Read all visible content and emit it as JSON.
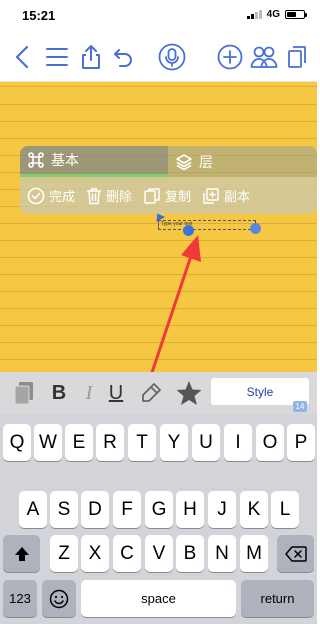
{
  "status": {
    "time": "15:21",
    "network": "4G"
  },
  "toolbar": {
    "buttons": [
      "back",
      "list",
      "share",
      "undo",
      "microphone",
      "add",
      "collaborators",
      "pages"
    ]
  },
  "menu": {
    "tabs": [
      {
        "label": "基本",
        "icon": "command-icon",
        "active": true
      },
      {
        "label": "层",
        "icon": "layers-icon",
        "active": false
      }
    ],
    "actions": [
      {
        "label": "完成",
        "icon": "check-circle-icon"
      },
      {
        "label": "删除",
        "icon": "trash-icon"
      },
      {
        "label": "复制",
        "icon": "copy-icon"
      },
      {
        "label": "副本",
        "icon": "duplicate-icon"
      }
    ]
  },
  "text_object": {
    "text": "Type your text"
  },
  "format_bar": {
    "bold": "B",
    "italic": "I",
    "underline": "U",
    "style_label": "Style",
    "style_badge": "14"
  },
  "keyboard": {
    "row1": [
      "Q",
      "W",
      "E",
      "R",
      "T",
      "Y",
      "U",
      "I",
      "O",
      "P"
    ],
    "row2": [
      "A",
      "S",
      "D",
      "F",
      "G",
      "H",
      "J",
      "K",
      "L"
    ],
    "row3": [
      "Z",
      "X",
      "C",
      "V",
      "B",
      "N",
      "M"
    ],
    "numbers_label": "123",
    "space_label": "space",
    "return_label": "return"
  },
  "colors": {
    "paper": "#f6c742",
    "accent_blue": "#4a6fd6",
    "annotation_red": "#f03a3a",
    "active_tab_underline": "#7fcf6a"
  }
}
